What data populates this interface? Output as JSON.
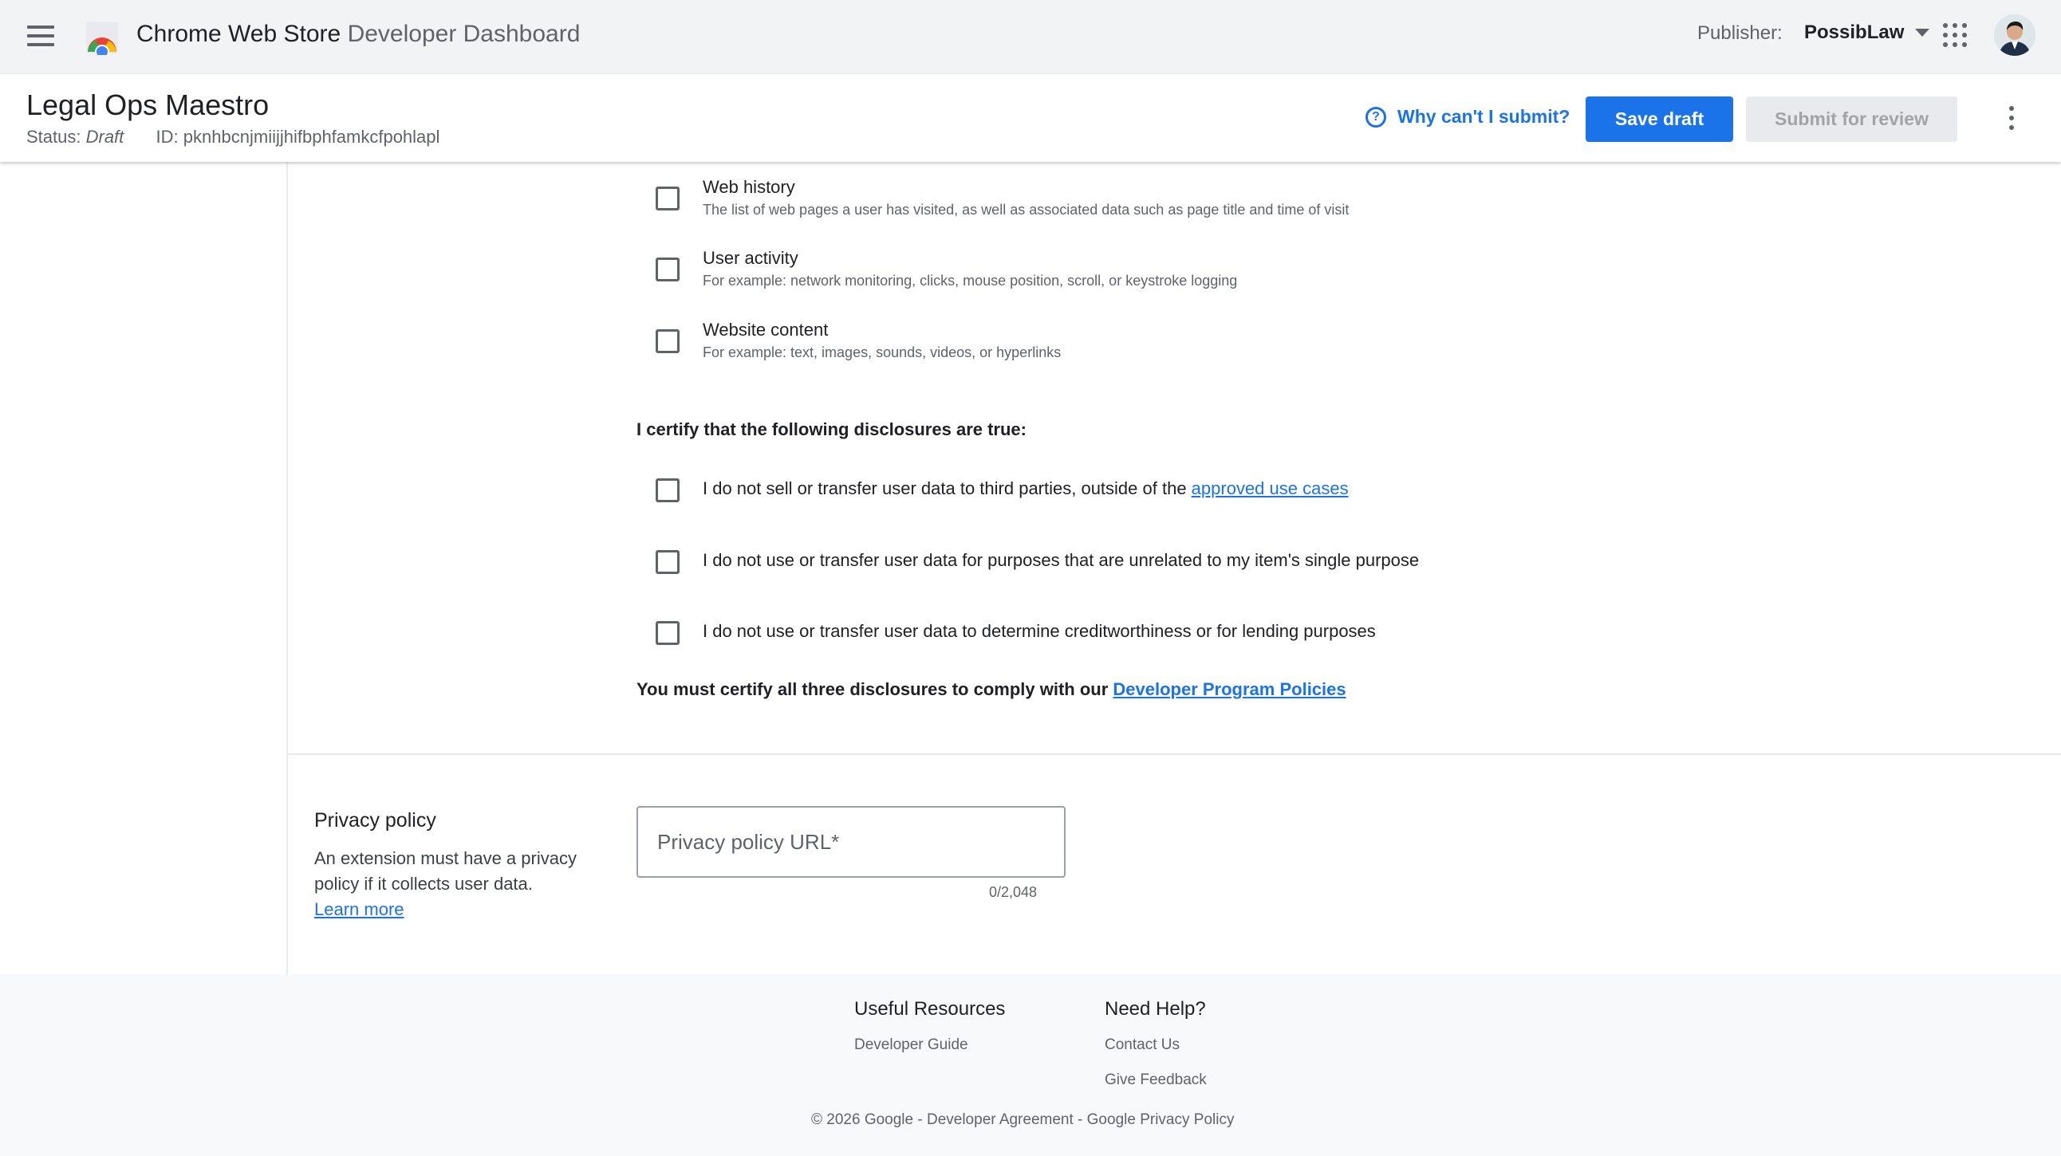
{
  "topbar": {
    "menu_icon": "hamburger-menu-icon",
    "logo_icon": "chrome-web-store-logo",
    "title": "Chrome Web Store",
    "subtitle": "Developer Dashboard",
    "publisher_label": "Publisher:",
    "publisher_name": "PossibLaw",
    "apps_icon": "apps-grid-icon",
    "avatar_icon": "user-avatar"
  },
  "item": {
    "title": "Legal Ops Maestro",
    "status_label": "Status:",
    "status_value": "Draft",
    "id_label": "ID:",
    "id_value": "pknhbcnjmiijjhifbphfamkcfpohlapl",
    "why_link": "Why can't I submit?",
    "save_draft": "Save draft",
    "submit_review": "Submit for review",
    "more_icon": "more-vert-icon"
  },
  "data_types": [
    {
      "label": "Web history",
      "description": "The list of web pages a user has visited, as well as associated data such as page title and time of visit",
      "checked": false
    },
    {
      "label": "User activity",
      "description": "For example: network monitoring, clicks, mouse position, scroll, or keystroke logging",
      "checked": false
    },
    {
      "label": "Website content",
      "description": "For example: text, images, sounds, videos, or hyperlinks",
      "checked": false
    }
  ],
  "certify": {
    "heading": "I certify that the following disclosures are true:",
    "items": [
      {
        "text": "I do not sell or transfer user data to third parties, outside of the ",
        "link": "approved use cases",
        "checked": false
      },
      {
        "text": "I do not use or transfer user data for purposes that are unrelated to my item's single purpose",
        "checked": false
      },
      {
        "text": "I do not use or transfer user data to determine creditworthiness or for lending purposes",
        "checked": false
      }
    ],
    "note": "You must certify all three disclosures to comply with our ",
    "note_link": "Developer Program Policies"
  },
  "privacy": {
    "title": "Privacy policy",
    "description": "An extension must have a privacy policy if it collects user data.",
    "learn_more": "Learn more",
    "input_placeholder": "Privacy policy URL*",
    "input_value": "",
    "counter": "0/2,048"
  },
  "footer": {
    "resources_heading": "Useful Resources",
    "resources_links": [
      "Developer Guide"
    ],
    "help_heading": "Need Help?",
    "help_links": [
      "Contact Us",
      "Give Feedback"
    ],
    "copyright": "© 2026 Google",
    "separator": " - ",
    "agreement": "Developer Agreement",
    "privacy_policy": "Google Privacy Policy"
  },
  "colors": {
    "accent": "#1a73e8",
    "topbar_bg": "#f1f3f4",
    "footer_bg": "#f8f9fa",
    "disabled_bg": "#e8eaed"
  }
}
